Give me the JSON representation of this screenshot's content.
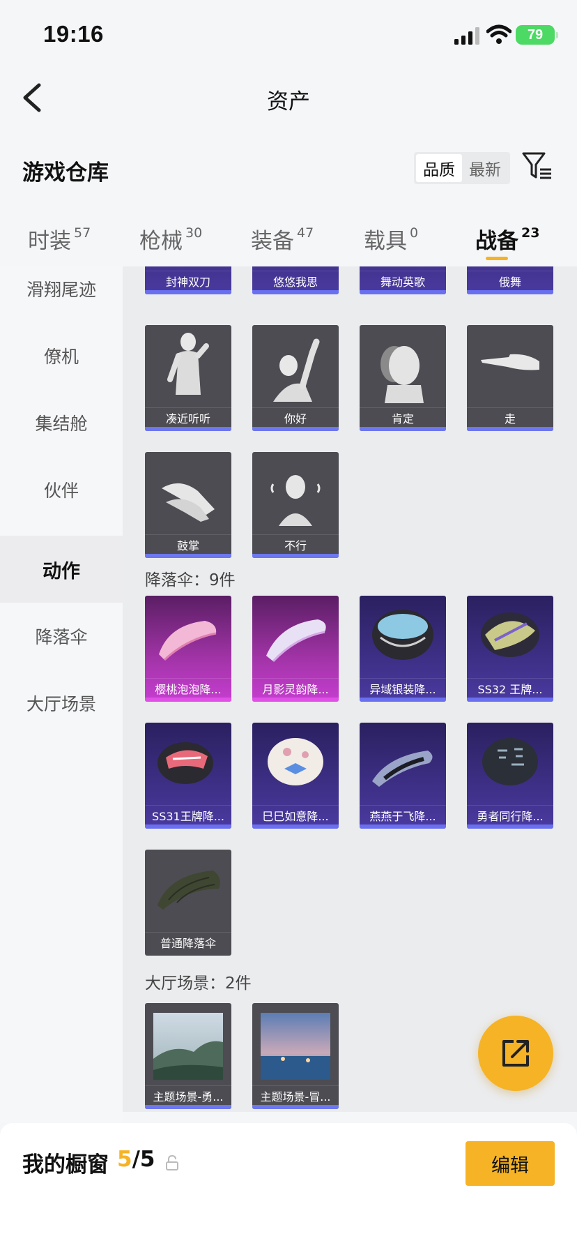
{
  "status": {
    "time": "19:16",
    "battery": "79"
  },
  "header": {
    "title": "资产"
  },
  "warehouse": {
    "title": "游戏仓库",
    "sort": [
      "品质",
      "最新"
    ]
  },
  "tabs": [
    {
      "label": "时装",
      "count": "57"
    },
    {
      "label": "枪械",
      "count": "30"
    },
    {
      "label": "装备",
      "count": "47"
    },
    {
      "label": "载具",
      "count": "0"
    },
    {
      "label": "战备",
      "count": "23",
      "active": true
    }
  ],
  "sidenav": [
    "滑翔尾迹",
    "僚机",
    "集结舱",
    "伙伴",
    "动作",
    "降落伞",
    "大厅场景"
  ],
  "actions": {
    "items": [
      "封神双刀",
      "悠悠我思",
      "舞动英歌",
      "俄舞",
      "凑近听听",
      "你好",
      "肯定",
      "走",
      "鼓掌",
      "不行"
    ]
  },
  "parachutes": {
    "title": "降落伞：9件",
    "items": [
      "樱桃泡泡降...",
      "月影灵韵降...",
      "异域银装降...",
      "SS32 王牌...",
      "SS31王牌降...",
      "巳巳如意降...",
      "燕燕于飞降...",
      "勇者同行降...",
      "普通降落伞"
    ]
  },
  "lobby": {
    "title": "大厅场景：2件",
    "items": [
      "主题场景-勇...",
      "主题场景-冒..."
    ]
  },
  "bottom": {
    "window_label": "我的橱窗",
    "used": "5",
    "separator": "/",
    "total": "5",
    "edit_label": "编辑"
  },
  "colors": {
    "accent": "#f5b325",
    "rare_bar": "#6a6ff0",
    "epic_bar": "#e04fe6"
  }
}
